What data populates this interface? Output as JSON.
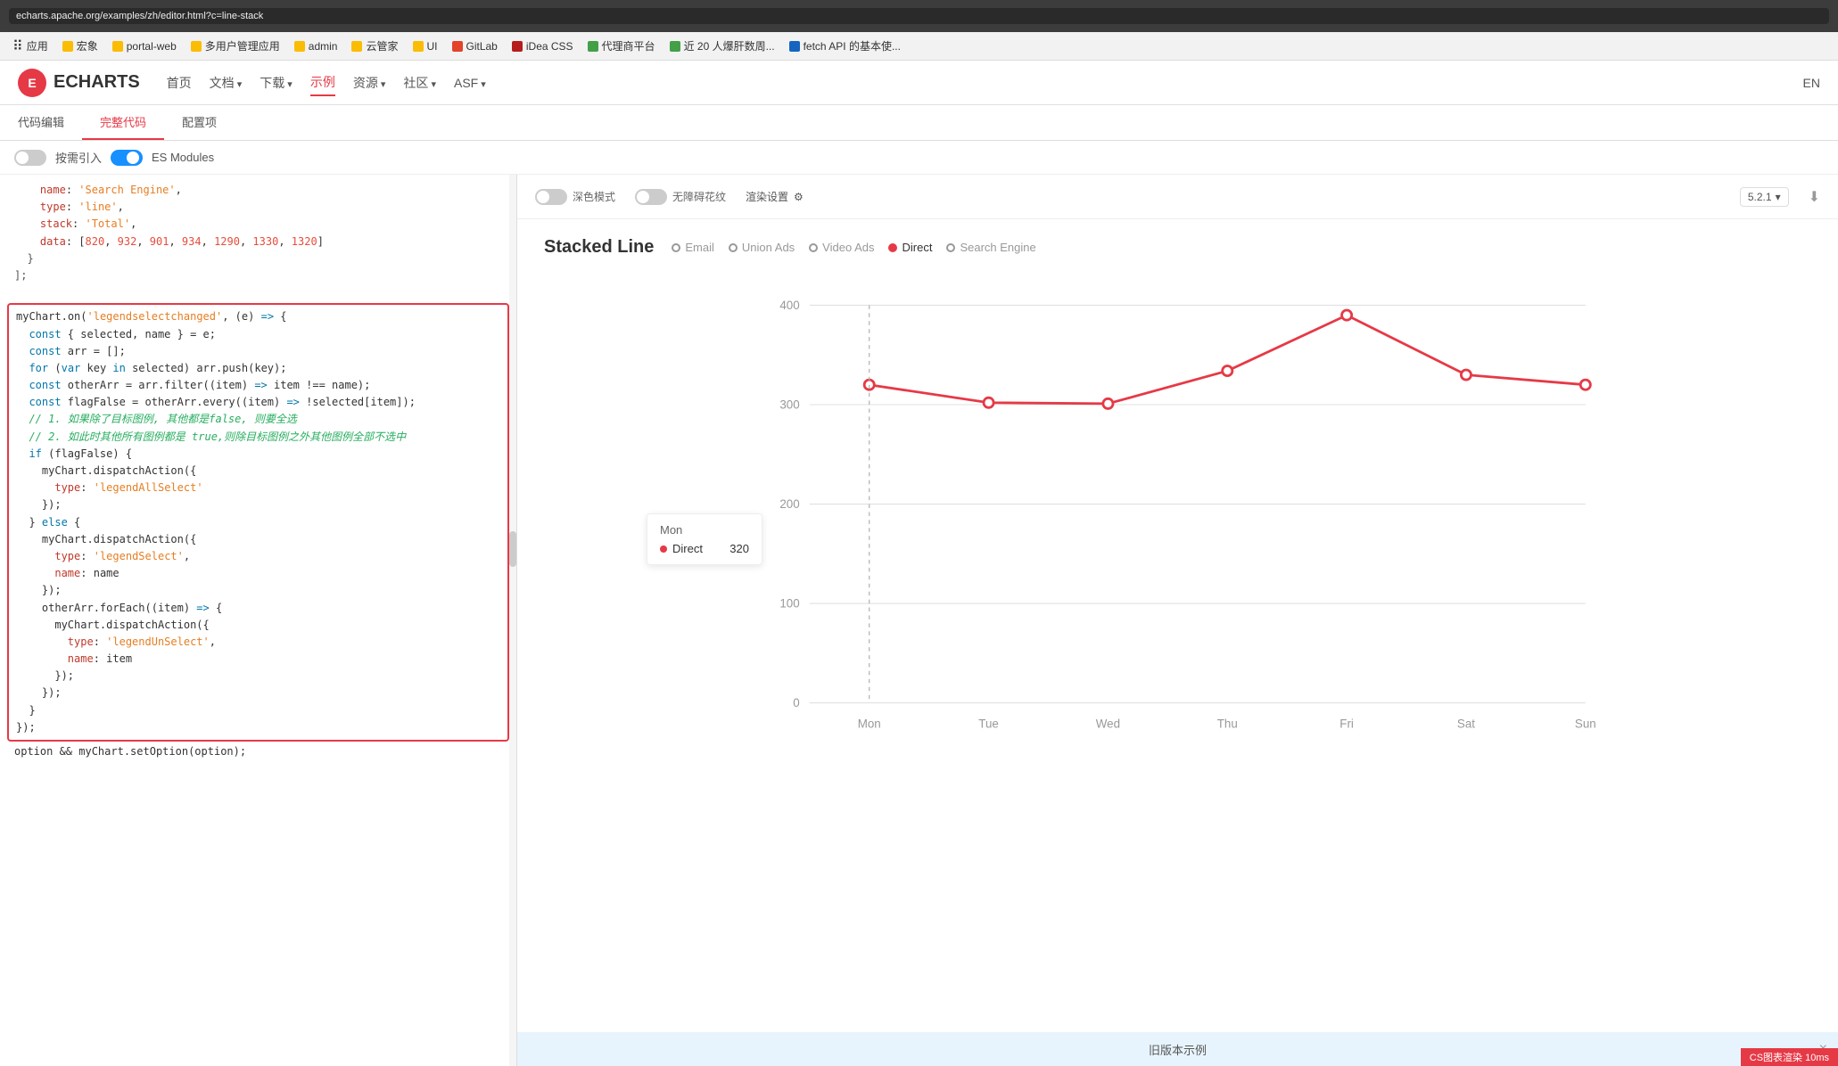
{
  "browser": {
    "url": "echarts.apache.org/examples/zh/editor.html?c=line-stack",
    "bookmarks": [
      {
        "label": "应用",
        "color": "#4285f4"
      },
      {
        "label": "宏象",
        "color": "#fbbc04"
      },
      {
        "label": "portal-web",
        "color": "#fbbc04"
      },
      {
        "label": "多用户管理应用",
        "color": "#fbbc04"
      },
      {
        "label": "admin",
        "color": "#fbbc04"
      },
      {
        "label": "云管家",
        "color": "#fbbc04"
      },
      {
        "label": "UI",
        "color": "#fbbc04"
      },
      {
        "label": "GitLab",
        "color": "#e2432a"
      },
      {
        "label": "iDea CSS",
        "color": "#b71c1c"
      },
      {
        "label": "代理商平台",
        "color": "#43a047"
      },
      {
        "label": "近 20 人爆肝数周...",
        "color": "#43a047"
      },
      {
        "label": "fetch API 的基本使...",
        "color": "#1565c0"
      }
    ]
  },
  "header": {
    "logo": "E",
    "brand": "ECHARTS",
    "nav": [
      {
        "label": "首页",
        "active": false
      },
      {
        "label": "文档",
        "active": false,
        "dropdown": true
      },
      {
        "label": "下载",
        "active": false,
        "dropdown": true
      },
      {
        "label": "示例",
        "active": true
      },
      {
        "label": "资源",
        "active": false,
        "dropdown": true
      },
      {
        "label": "社区",
        "active": false,
        "dropdown": true
      },
      {
        "label": "ASF",
        "active": false,
        "dropdown": true
      }
    ],
    "lang": "EN"
  },
  "tabs": [
    {
      "label": "代码编辑",
      "active": false
    },
    {
      "label": "完整代码",
      "active": true
    },
    {
      "label": "配置项",
      "active": false
    }
  ],
  "toggle": {
    "label": "按需引入",
    "es_modules": "ES Modules",
    "on": true
  },
  "code": {
    "lines": [
      "    name: 'Search Engine',",
      "    type: 'line',",
      "    stack: 'Total',",
      "    data: [820, 932, 901, 934, 1290, 1330, 1320]",
      "  }",
      "];",
      "",
      "myChart.on('legendselectchanged', (e) => {",
      "  const { selected, name } = e;",
      "  const arr = [];",
      "  for (var key in selected) arr.push(key);",
      "  const otherArr = arr.filter((item) => item !== name);",
      "  const flagFalse = otherArr.every((item) => !selected[item]);",
      "  // 1. 如果除了目标图例, 其他都是false, 则要全选",
      "  // 2. 如此时其他所有图例都是 true,则除目标图例之外其他图例全部不选中",
      "  if (flagFalse) {",
      "    myChart.dispatchAction({",
      "      type: 'legendAllSelect'",
      "    });",
      "  } else {",
      "    myChart.dispatchAction({",
      "      type: 'legendSelect',",
      "      name: name",
      "    });",
      "    otherArr.forEach((item) => {",
      "      myChart.dispatchAction({",
      "        type: 'legendUnSelect',",
      "        name: item",
      "      });",
      "    });",
      "  }",
      "});",
      "",
      "option && myChart.setOption(option);"
    ]
  },
  "chart": {
    "toolbar": {
      "dark_mode": "深色模式",
      "no_border": "无障碍花纹",
      "render_settings": "渲染设置",
      "version": "5.2.1",
      "download_icon": "⬇"
    },
    "title": "Stacked Line",
    "legend": [
      {
        "label": "Email",
        "active": false,
        "color": "#999"
      },
      {
        "label": "Union Ads",
        "active": false,
        "color": "#999"
      },
      {
        "label": "Video Ads",
        "active": false,
        "color": "#999"
      },
      {
        "label": "Direct",
        "active": true,
        "color": "#e63946"
      },
      {
        "label": "Search Engine",
        "active": false,
        "color": "#999"
      }
    ],
    "y_axis": [
      0,
      100,
      200,
      300,
      400
    ],
    "x_axis": [
      "Mon",
      "Tue",
      "Wed",
      "Thu",
      "Fri",
      "Sat",
      "Sun"
    ],
    "series": {
      "direct": [
        320,
        302,
        301,
        334,
        390,
        330,
        320
      ]
    },
    "tooltip": {
      "title": "Mon",
      "label": "Direct",
      "value": "320",
      "color": "#e63946"
    }
  },
  "old_version_banner": {
    "label": "旧版本示例",
    "close": "×"
  },
  "status_bar": {
    "label": "CS图表渲染 10ms"
  }
}
